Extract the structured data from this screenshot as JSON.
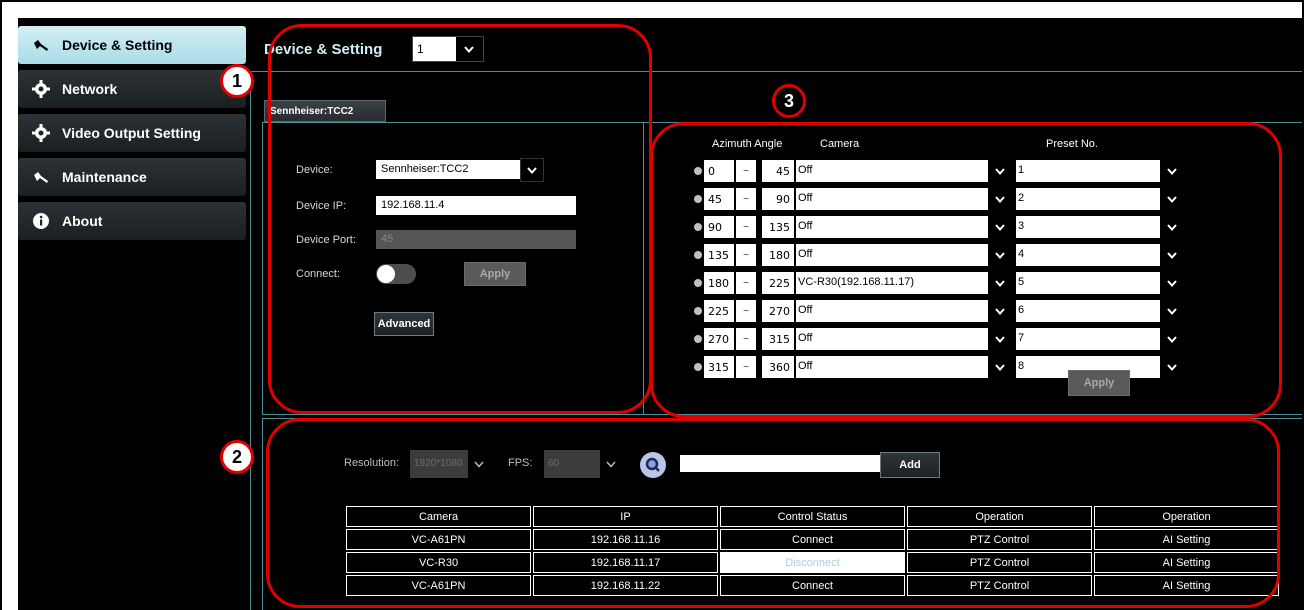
{
  "sidebar": {
    "items": [
      {
        "label": "Device & Setting",
        "icon": "wrench-icon",
        "active": true
      },
      {
        "label": "Network",
        "icon": "gear-icon"
      },
      {
        "label": "Video Output Setting",
        "icon": "gear-icon"
      },
      {
        "label": "Maintenance",
        "icon": "wrench-icon"
      },
      {
        "label": "About",
        "icon": "info-icon"
      }
    ]
  },
  "header": {
    "title": "Device & Setting",
    "device_select_value": "1"
  },
  "tab": {
    "label": "Sennheiser:TCC2"
  },
  "device_panel": {
    "device_label": "Device:",
    "device_value": "Sennheiser:TCC2",
    "ip_label": "Device IP:",
    "ip_value": "192.168.11.4",
    "port_label": "Device Port:",
    "port_value": "45",
    "connect_label": "Connect:",
    "connect_on": false,
    "apply_label": "Apply",
    "advanced_label": "Advanced"
  },
  "azimuth": {
    "headers": {
      "angle": "Azimuth Angle",
      "camera": "Camera",
      "preset": "Preset No."
    },
    "separator": "~",
    "rows": [
      {
        "from": "0",
        "to": "45",
        "camera": "Off",
        "preset": "1"
      },
      {
        "from": "45",
        "to": "90",
        "camera": "Off",
        "preset": "2"
      },
      {
        "from": "90",
        "to": "135",
        "camera": "Off",
        "preset": "3"
      },
      {
        "from": "135",
        "to": "180",
        "camera": "Off",
        "preset": "4"
      },
      {
        "from": "180",
        "to": "225",
        "camera": "VC-R30(192.168.11.17)",
        "preset": "5"
      },
      {
        "from": "225",
        "to": "270",
        "camera": "Off",
        "preset": "6"
      },
      {
        "from": "270",
        "to": "315",
        "camera": "Off",
        "preset": "7"
      },
      {
        "from": "315",
        "to": "360",
        "camera": "Off",
        "preset": "8"
      }
    ],
    "apply_label": "Apply"
  },
  "camera_add": {
    "resolution_label": "Resolution:",
    "resolution_value": "1920*1080",
    "fps_label": "FPS:",
    "fps_value": "60",
    "ip_input_value": "",
    "add_label": "Add"
  },
  "camera_table": {
    "headers": [
      "Camera",
      "IP",
      "Control Status",
      "Operation",
      "Operation"
    ],
    "rows": [
      [
        "VC-A61PN",
        "192.168.11.16",
        "Connect",
        "PTZ Control",
        "AI Setting"
      ],
      [
        "VC-R30",
        "192.168.11.17",
        "Disconnect",
        "PTZ Control",
        "AI Setting"
      ],
      [
        "VC-A61PN",
        "192.168.11.22",
        "Connect",
        "PTZ Control",
        "AI Setting"
      ]
    ]
  },
  "annotations": {
    "one": "1",
    "two": "2",
    "three": "3"
  },
  "colors": {
    "annotation": "#e00000",
    "panel_line": "#4a8e98",
    "active_nav": "#a9dde8"
  }
}
